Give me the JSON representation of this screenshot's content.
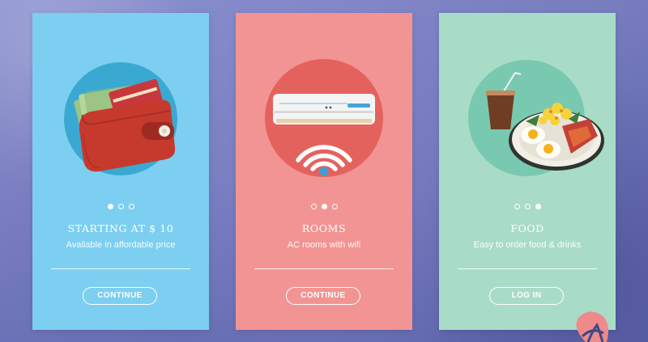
{
  "cards": [
    {
      "title": "STARTING AT $ 10",
      "subtitle": "Available in affordable price",
      "button_label": "CONTINUE",
      "active_dot": 1,
      "bg_color": "#7ccff0",
      "circle_color": "#3aa9d2",
      "icon": "wallet-icon"
    },
    {
      "title": "ROOMS",
      "subtitle": "AC rooms with wifi",
      "button_label": "CONTINUE",
      "active_dot": 2,
      "bg_color": "#f29493",
      "circle_color": "#e4625e",
      "icon": "air-conditioner-icon"
    },
    {
      "title": "FOOD",
      "subtitle": "Easy to order food & drinks",
      "button_label": "LOG IN",
      "active_dot": 3,
      "bg_color": "#a9dcc6",
      "circle_color": "#79c9b0",
      "icon": "food-plate-icon"
    }
  ],
  "page": {
    "bg_color": "#7a80c2"
  }
}
